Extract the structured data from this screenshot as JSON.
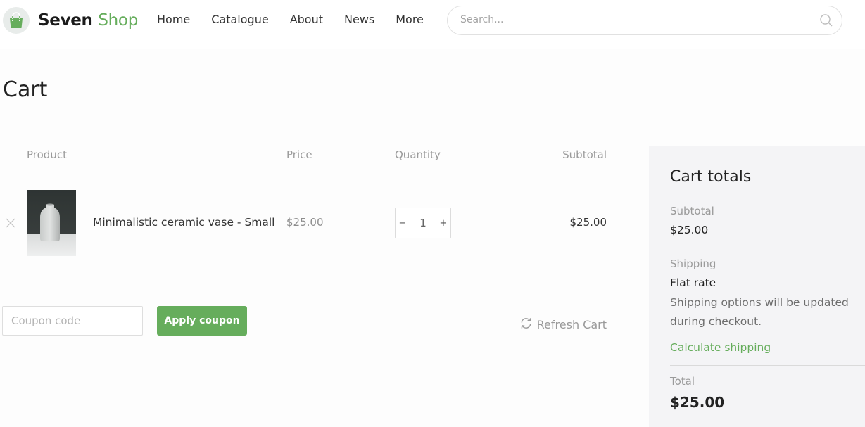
{
  "header": {
    "logo": {
      "brand_first": "Seven",
      "brand_second": "Shop",
      "icon": "shopping-bag-icon"
    },
    "nav": [
      {
        "label": "Home"
      },
      {
        "label": "Catalogue"
      },
      {
        "label": "About"
      },
      {
        "label": "News"
      },
      {
        "label": "More"
      }
    ],
    "search": {
      "placeholder": "Search...",
      "value": "",
      "icon": "search-icon"
    }
  },
  "page": {
    "title": "Cart"
  },
  "cart_table": {
    "columns": [
      "Product",
      "Price",
      "Quantity",
      "Subtotal"
    ],
    "rows": [
      {
        "name": "Minimalistic ceramic vase - Small",
        "price": "$25.00",
        "quantity": "1",
        "subtotal": "$25.00",
        "remove_icon": "close-icon",
        "decrement_label": "−",
        "increment_label": "+"
      }
    ]
  },
  "coupon": {
    "placeholder": "Coupon code",
    "value": "",
    "apply_label": "Apply coupon"
  },
  "refresh": {
    "label": "Refresh Cart",
    "icon": "refresh-icon"
  },
  "totals": {
    "title": "Cart totals",
    "subtotal_label": "Subtotal",
    "subtotal_value": "$25.00",
    "shipping_label": "Shipping",
    "shipping_method": "Flat rate",
    "shipping_note": "Shipping options will be updated during checkout.",
    "calculate_link": "Calculate shipping",
    "total_label": "Total",
    "total_value": "$25.00"
  },
  "colors": {
    "accent": "#66ad5c",
    "panel_bg": "#f4f4f6"
  }
}
